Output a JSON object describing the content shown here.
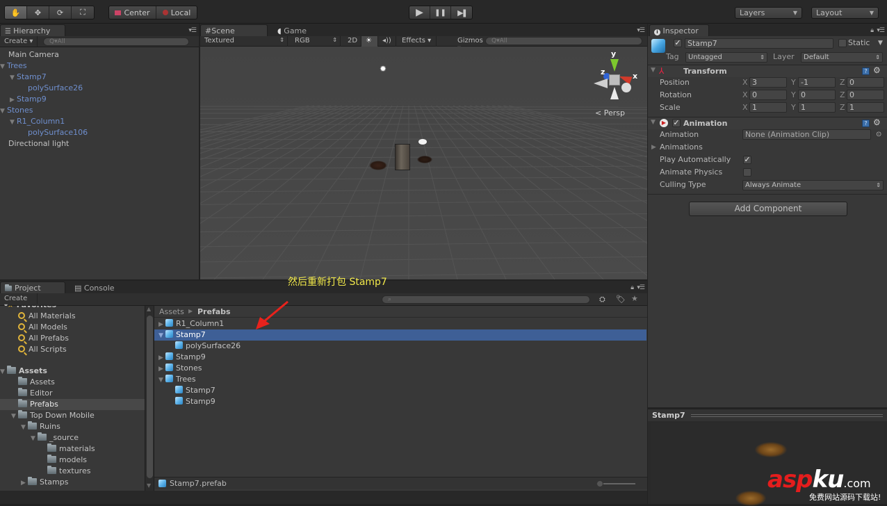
{
  "toolbar": {
    "tools": [
      {
        "name": "hand-tool",
        "glyph": "✋"
      },
      {
        "name": "move-tool",
        "glyph": "✥"
      },
      {
        "name": "rotate-tool",
        "glyph": "⟳"
      },
      {
        "name": "scale-tool",
        "glyph": "⛶"
      }
    ],
    "pivot": "Center",
    "space": "Local",
    "play": "▶",
    "pause": "❚❚",
    "step": "▶❚",
    "layers": "Layers",
    "layout": "Layout"
  },
  "hierarchy": {
    "tab": "Hierarchy",
    "create": "Create",
    "search_placeholder": "Q▾All",
    "items": [
      {
        "label": "Main Camera",
        "depth": 0,
        "arrow": "",
        "prefab": false
      },
      {
        "label": "Trees",
        "depth": 0,
        "arrow": "▼",
        "prefab": true
      },
      {
        "label": "Stamp7",
        "depth": 1,
        "arrow": "▼",
        "prefab": true
      },
      {
        "label": "polySurface26",
        "depth": 2,
        "arrow": "",
        "prefab": true
      },
      {
        "label": "Stamp9",
        "depth": 1,
        "arrow": "▶",
        "prefab": true
      },
      {
        "label": "Stones",
        "depth": 0,
        "arrow": "▼",
        "prefab": true
      },
      {
        "label": "R1_Column1",
        "depth": 1,
        "arrow": "▼",
        "prefab": true
      },
      {
        "label": "polySurface106",
        "depth": 2,
        "arrow": "",
        "prefab": true
      },
      {
        "label": "Directional light",
        "depth": 0,
        "arrow": "",
        "prefab": false
      }
    ]
  },
  "scene": {
    "tabs": [
      "Scene",
      "Game"
    ],
    "shading": "Textured",
    "render_mode": "RGB",
    "mode_2d": "2D",
    "effects": "Effects",
    "gizmos": "Gizmos",
    "search_placeholder": "Q▾All",
    "gizmo_labels": {
      "x": "x",
      "y": "y",
      "z": "z"
    },
    "projection": "Persp"
  },
  "inspector": {
    "tab": "Inspector",
    "object_name": "Stamp7",
    "active": true,
    "static_label": "Static",
    "tag_label": "Tag",
    "tag_value": "Untagged",
    "layer_label": "Layer",
    "layer_value": "Default",
    "transform": {
      "title": "Transform",
      "rows": [
        {
          "label": "Position",
          "x": "3",
          "y": "-1",
          "z": "0"
        },
        {
          "label": "Rotation",
          "x": "0",
          "y": "0",
          "z": "0"
        },
        {
          "label": "Scale",
          "x": "1",
          "y": "1",
          "z": "1"
        }
      ]
    },
    "animation": {
      "title": "Animation",
      "enabled": true,
      "animation_label": "Animation",
      "animation_value": "None (Animation Clip)",
      "animations_label": "Animations",
      "play_auto_label": "Play Automatically",
      "play_auto": true,
      "physics_label": "Animate Physics",
      "physics": false,
      "culling_label": "Culling Type",
      "culling_value": "Always Animate"
    },
    "add_component": "Add Component"
  },
  "preview": {
    "title": "Stamp7"
  },
  "project": {
    "tabs": [
      "Project",
      "Console"
    ],
    "create": "Create",
    "favorites_label": "Favorites",
    "favorites": [
      "All Materials",
      "All Models",
      "All Prefabs",
      "All Scripts"
    ],
    "folders": [
      {
        "label": "Assets",
        "depth": 0,
        "arrow": "▼",
        "bold": true
      },
      {
        "label": "Assets",
        "depth": 1,
        "arrow": ""
      },
      {
        "label": "Editor",
        "depth": 1,
        "arrow": ""
      },
      {
        "label": "Prefabs",
        "depth": 1,
        "arrow": "",
        "selected": true
      },
      {
        "label": "Top Down Mobile",
        "depth": 1,
        "arrow": "▼"
      },
      {
        "label": "Ruins",
        "depth": 2,
        "arrow": "▼"
      },
      {
        "label": "_source",
        "depth": 3,
        "arrow": "▼"
      },
      {
        "label": "materials",
        "depth": 4,
        "arrow": ""
      },
      {
        "label": "models",
        "depth": 4,
        "arrow": ""
      },
      {
        "label": "textures",
        "depth": 4,
        "arrow": ""
      },
      {
        "label": "Stamps",
        "depth": 2,
        "arrow": "▶"
      }
    ],
    "breadcrumb": [
      "Assets",
      "Prefabs"
    ],
    "assets": [
      {
        "label": "R1_Column1",
        "depth": 0,
        "arrow": "▶"
      },
      {
        "label": "Stamp7",
        "depth": 0,
        "arrow": "▼",
        "selected": true
      },
      {
        "label": "polySurface26",
        "depth": 1,
        "arrow": ""
      },
      {
        "label": "Stamp9",
        "depth": 0,
        "arrow": "▶"
      },
      {
        "label": "Stones",
        "depth": 0,
        "arrow": "▶"
      },
      {
        "label": "Trees",
        "depth": 0,
        "arrow": "▼"
      },
      {
        "label": "Stamp7",
        "depth": 1,
        "arrow": ""
      },
      {
        "label": "Stamp9",
        "depth": 1,
        "arrow": ""
      }
    ],
    "selected_file": "Stamp7.prefab"
  },
  "annotation": {
    "text": "然后重新打包 Stamp7",
    "color": "#f2e94a",
    "arrow_color": "#e8221c"
  },
  "watermark": {
    "brand_red": "asp",
    "brand_white": "ku",
    "suffix": ".com",
    "tagline": "免费网站源码下载站!"
  },
  "colors": {
    "selection": "#3e5f96",
    "prefab_text": "#6f8fce"
  }
}
